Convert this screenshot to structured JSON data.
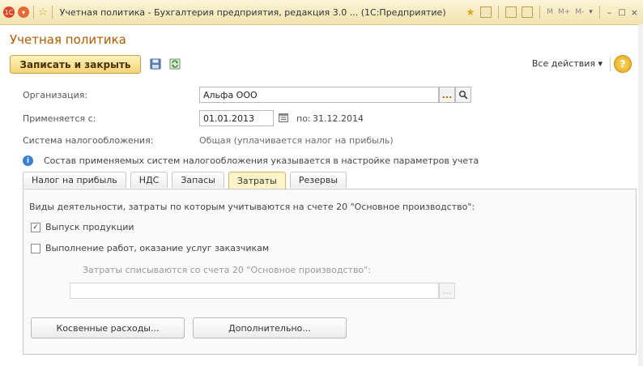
{
  "window": {
    "title": "Учетная политика - Бухгалтерия предприятия, редакция 3.0 ... (1С:Предприятие)",
    "app_badge": "1С",
    "buttons": [
      "M",
      "M+",
      "M-"
    ]
  },
  "form": {
    "title": "Учетная политика"
  },
  "toolbar": {
    "save_close_label": "Записать и закрыть",
    "all_actions_label": "Все действия ▾",
    "help_label": "?"
  },
  "fields": {
    "organization_label": "Организация:",
    "organization_value": "Альфа ООО",
    "applies_from_label": "Применяется с:",
    "applies_from_value": "01.01.2013",
    "applies_to_label": "по:",
    "applies_to_value": "31.12.2014",
    "tax_system_label": "Система налогообложения:",
    "tax_system_value": "Общая (уплачивается налог на прибыль)",
    "info_text": "Состав применяемых систем налогообложения указывается в настройке параметров учета"
  },
  "tabs": [
    {
      "label": "Налог на прибыль",
      "active": false
    },
    {
      "label": "НДС",
      "active": false
    },
    {
      "label": "Запасы",
      "active": false
    },
    {
      "label": "Затраты",
      "active": true
    },
    {
      "label": "Резервы",
      "active": false
    }
  ],
  "costs_panel": {
    "heading": "Виды деятельности, затраты по которым учитываются на счете 20 \"Основное производство\":",
    "option1_label": "Выпуск продукции",
    "option1_checked": true,
    "option2_label": "Выполнение работ, оказание услуг заказчикам",
    "option2_checked": false,
    "writeoff_label": "Затраты списываются со счета 20 \"Основное производство\":",
    "writeoff_value": "",
    "indirect_button": "Косвенные расходы...",
    "more_button": "Дополнительно..."
  },
  "icons": {
    "select_dots": "...",
    "calendar": "calendar-icon",
    "search": "search-icon",
    "info": "info-icon",
    "save": "save-icon",
    "refresh": "refresh-icon"
  }
}
